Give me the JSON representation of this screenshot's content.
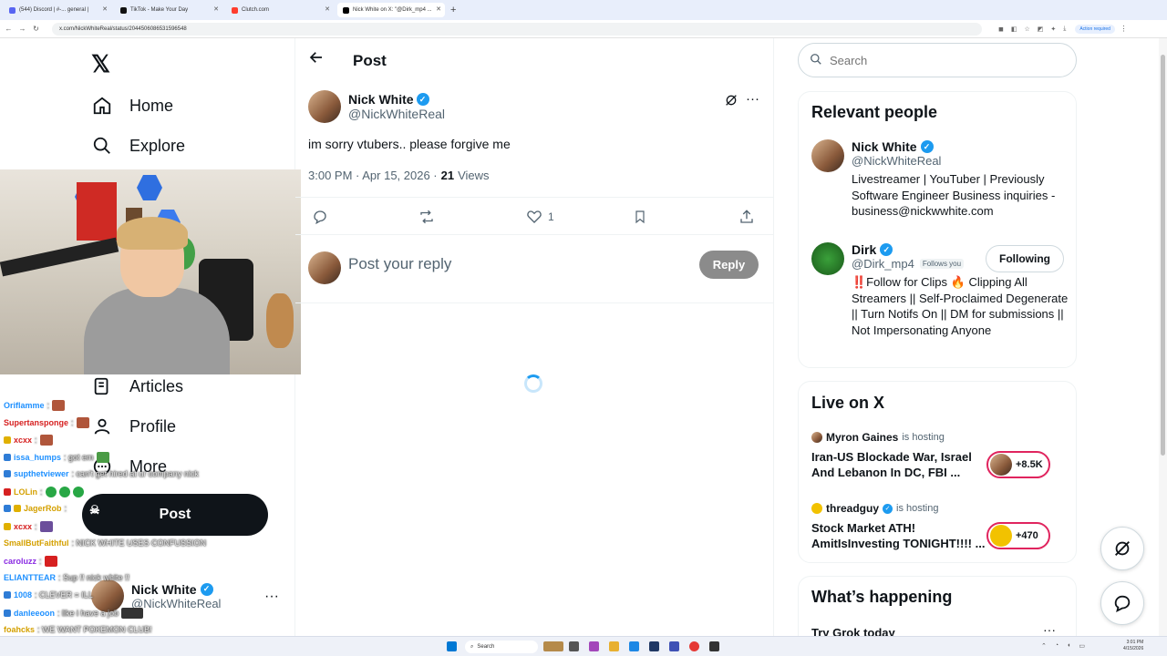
{
  "browser": {
    "tabs": [
      {
        "label": "(544) Discord | #-... general |"
      },
      {
        "label": "TikTok - Make Your Day"
      },
      {
        "label": "Clutch.com"
      },
      {
        "label": "Nick White on X: \"@Dirk_mp4 ..."
      }
    ],
    "url": "x.com/NickWhiteReal/status/2044506086531596548",
    "profile_chip": "Action required"
  },
  "leftnav": {
    "items": [
      {
        "label": "Home"
      },
      {
        "label": "Explore"
      },
      {
        "label": "Articles"
      },
      {
        "label": "Profile"
      },
      {
        "label": "More"
      }
    ],
    "post_label": "Post",
    "account": {
      "name": "Nick White",
      "handle": "@NickWhiteReal"
    }
  },
  "chat": [
    {
      "user": "Oriflamme",
      "msg": ":"
    },
    {
      "user": "Supertansponge",
      "msg": ":"
    },
    {
      "user": "xcxx",
      "msg": ":"
    },
    {
      "user": "issa_humps",
      "msg": ": got em"
    },
    {
      "user": "supthetviewer",
      "msg": ": can't get hired at ur company nick"
    },
    {
      "user": "LOLin",
      "msg": ":"
    },
    {
      "user": "JagerRob",
      "msg": ":"
    },
    {
      "user": "xcxx",
      "msg": ":"
    },
    {
      "user": "SmallButFaithful",
      "msg": ": NICK WHITE USES CONFUSSION"
    },
    {
      "user": "caroluzz",
      "msg": ":"
    },
    {
      "user": "ELIANTTEAR",
      "msg": ": Sup !! nick white !!"
    },
    {
      "user": "1008",
      "msg": ": CLEVER = ILL"
    },
    {
      "user": "danleeoon",
      "msg": ": like i have a job"
    },
    {
      "user": "foahcks",
      "msg": ": WE WANT POKEMON CLUB!"
    },
    {
      "user": "xcxx",
      "msg": ":"
    }
  ],
  "main": {
    "header_title": "Post",
    "author": {
      "name": "Nick White",
      "handle": "@NickWhiteReal"
    },
    "text": "im sorry vtubers.. please forgive me",
    "time": "3:00 PM · Apr 15, 2026 ·",
    "views_count": "21",
    "views_label": "Views",
    "like_count": "1",
    "reply_placeholder": "Post your reply",
    "reply_button": "Reply"
  },
  "sidebar": {
    "search_placeholder": "Search",
    "relevant_title": "Relevant people",
    "people": [
      {
        "name": "Nick White",
        "handle": "@NickWhiteReal",
        "bio": "Livestreamer | YouTuber | Previously Software Engineer Business inquiries - business@nickwwhite.com"
      },
      {
        "name": "Dirk",
        "handle": "@Dirk_mp4",
        "follows_you": "Follows you",
        "bio": "‼️Follow for Clips 🔥 Clipping All Streamers || Self-Proclaimed Degenerate || Turn Notifs On || DM for submissions || Not Impersonating Anyone",
        "button": "Following"
      }
    ],
    "live_title": "Live on X",
    "live": [
      {
        "host": "Myron Gaines",
        "suffix": "is hosting",
        "title": "Iran-US Blockade War, Israel And Lebanon In DC, FBI ...",
        "count": "+8.5K"
      },
      {
        "host": "threadguy",
        "suffix": "is hosting",
        "title": "Stock Market ATH! AmitIsInvesting TONIGHT!!!! ...",
        "count": "+470"
      }
    ],
    "happening_title": "What’s happening",
    "happening_first": "Try Grok today"
  },
  "taskbar": {
    "search": "Search",
    "time": "3:01 PM",
    "date": "4/15/2026"
  },
  "colors": {
    "accent": "#1d9bf0",
    "text": "#0f1419",
    "muted": "#536471",
    "live": "#e0245e"
  }
}
